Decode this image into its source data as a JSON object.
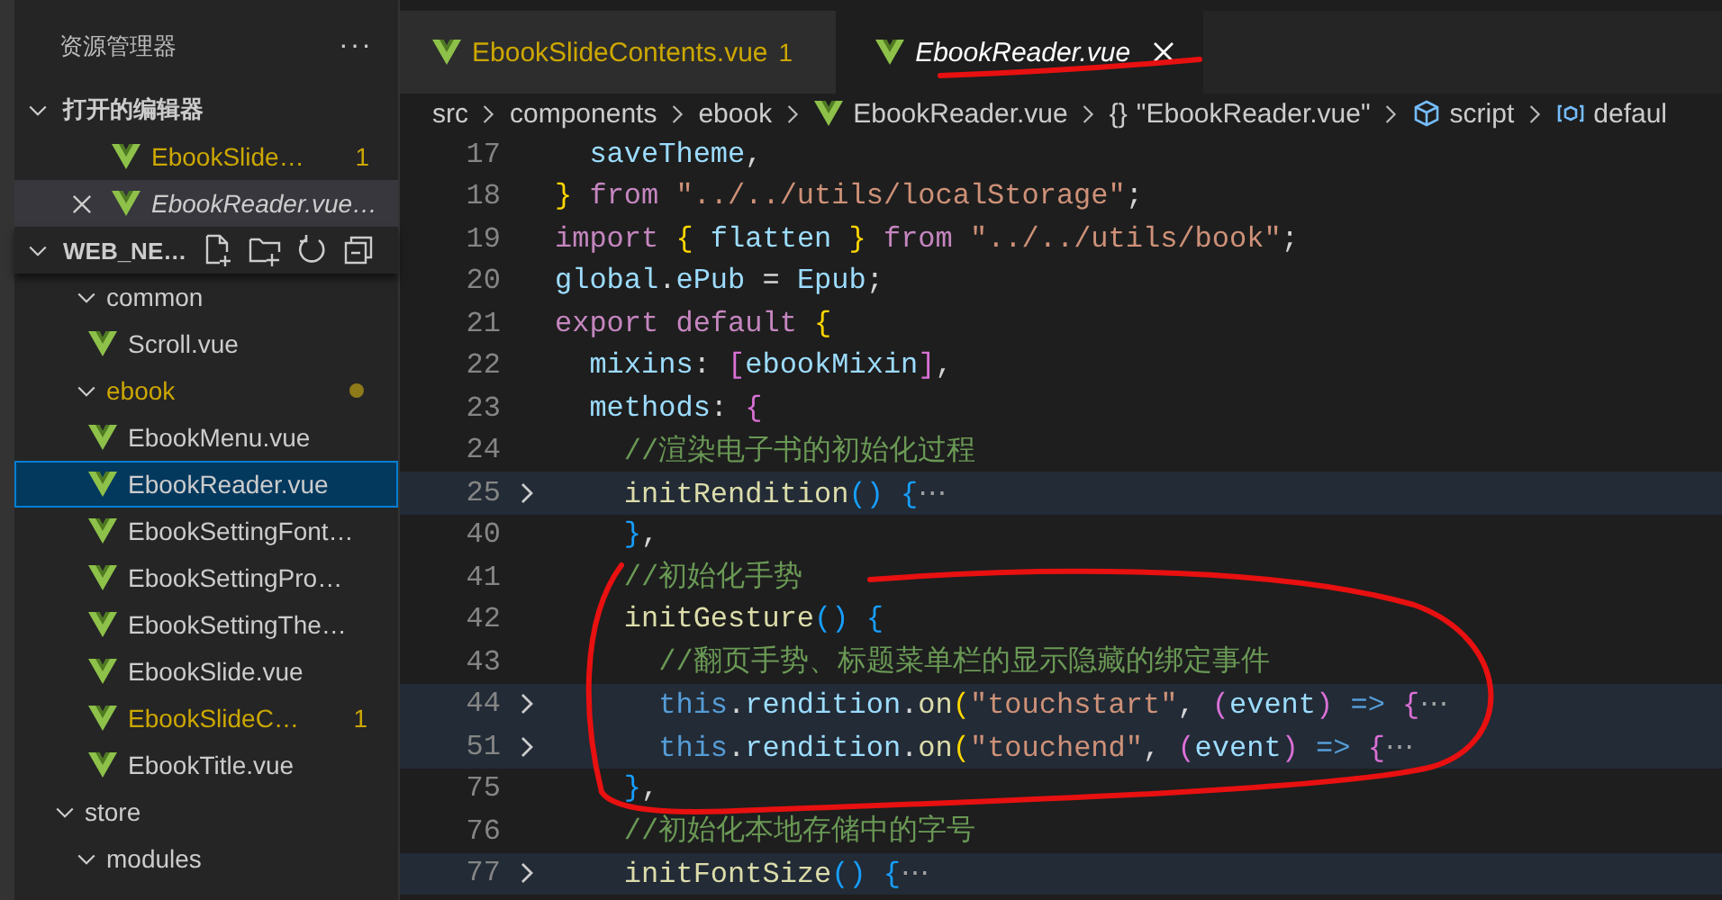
{
  "explorer": {
    "title": "资源管理器",
    "more": "···",
    "open_editors": {
      "title": "打开的编辑器",
      "expanded": true,
      "items": [
        {
          "label": "EbookSlide…",
          "problem": true,
          "badge": "1",
          "preview": false,
          "selected": false
        },
        {
          "label": "EbookReader.vue…",
          "problem": false,
          "preview": true,
          "selected": true
        }
      ]
    },
    "project": {
      "title": "WEB_NE…",
      "expanded": true,
      "tree": [
        {
          "children": [
            {
              "label": "common",
              "kind": "folder",
              "expanded": true,
              "problem": false,
              "children": [
                {
                  "label": "Scroll.vue",
                  "kind": "file",
                  "selected": false,
                  "problem": false
                }
              ]
            },
            {
              "label": "ebook",
              "kind": "folder",
              "expanded": true,
              "problem": true,
              "children": [
                {
                  "label": "EbookMenu.vue",
                  "kind": "file",
                  "selected": false,
                  "problem": false
                },
                {
                  "label": "EbookReader.vue",
                  "kind": "file",
                  "selected": true,
                  "problem": false
                },
                {
                  "label": "EbookSettingFont…",
                  "kind": "file",
                  "selected": false,
                  "problem": false
                },
                {
                  "label": "EbookSettingPro…",
                  "kind": "file",
                  "selected": false,
                  "problem": false
                },
                {
                  "label": "EbookSettingThe…",
                  "kind": "file",
                  "selected": false,
                  "problem": false
                },
                {
                  "label": "EbookSlide.vue",
                  "kind": "file",
                  "selected": false,
                  "problem": false
                },
                {
                  "label": "EbookSlideC…",
                  "kind": "file",
                  "selected": false,
                  "problem": true,
                  "badge": "1"
                },
                {
                  "label": "EbookTitle.vue",
                  "kind": "file",
                  "selected": false,
                  "problem": false
                }
              ]
            }
          ]
        },
        {
          "label": "store",
          "kind": "folder",
          "expanded": true,
          "problem": false,
          "children": [
            {
              "label": "modules",
              "kind": "folder",
              "expanded": true,
              "problem": false
            }
          ]
        }
      ]
    }
  },
  "tabs": [
    {
      "label": "EbookSlideContents.vue",
      "badge": "1",
      "problem": true,
      "preview": false,
      "selected": false
    },
    {
      "label": "EbookReader.vue",
      "problem": false,
      "preview": true,
      "selected": true
    }
  ],
  "breadcrumb": [
    {
      "label": "src",
      "kind": "folder"
    },
    {
      "label": "components",
      "kind": "folder"
    },
    {
      "label": "ebook",
      "kind": "folder"
    },
    {
      "label": "EbookReader.vue",
      "kind": "vue"
    },
    {
      "label": "\"EbookReader.vue\"",
      "kind": "module",
      "symbol": "{}"
    },
    {
      "label": "script",
      "kind": "element"
    },
    {
      "label": "defaul",
      "kind": "field"
    }
  ],
  "code": [
    {
      "number": "17",
      "folded": false,
      "tokens": [
        {
          "text": "  saveTheme",
          "kind": "var"
        },
        {
          "text": ",",
          "kind": "plain"
        }
      ]
    },
    {
      "number": "18",
      "folded": false,
      "tokens": [
        {
          "text": "}",
          "kind": "b1"
        },
        {
          "text": " from ",
          "kind": "kw"
        },
        {
          "text": "\"../../utils/localStorage\"",
          "kind": "str"
        },
        {
          "text": ";",
          "kind": "plain"
        }
      ]
    },
    {
      "number": "19",
      "folded": false,
      "tokens": [
        {
          "text": "import ",
          "kind": "kw"
        },
        {
          "text": "{",
          "kind": "b1"
        },
        {
          "text": " flatten ",
          "kind": "var"
        },
        {
          "text": "}",
          "kind": "b1"
        },
        {
          "text": " from ",
          "kind": "kw"
        },
        {
          "text": "\"../../utils/book\"",
          "kind": "str"
        },
        {
          "text": ";",
          "kind": "plain"
        }
      ]
    },
    {
      "number": "20",
      "folded": false,
      "tokens": [
        {
          "text": "global",
          "kind": "var"
        },
        {
          "text": ".",
          "kind": "plain"
        },
        {
          "text": "ePub",
          "kind": "var"
        },
        {
          "text": " = ",
          "kind": "plain"
        },
        {
          "text": "Epub",
          "kind": "var"
        },
        {
          "text": ";",
          "kind": "plain"
        }
      ]
    },
    {
      "number": "21",
      "folded": false,
      "tokens": [
        {
          "text": "export default ",
          "kind": "kw"
        },
        {
          "text": "{",
          "kind": "b1"
        }
      ]
    },
    {
      "number": "22",
      "folded": false,
      "tokens": [
        {
          "text": "  mixins",
          "kind": "var"
        },
        {
          "text": ": ",
          "kind": "plain"
        },
        {
          "text": "[",
          "kind": "b2"
        },
        {
          "text": "ebookMixin",
          "kind": "var"
        },
        {
          "text": "]",
          "kind": "b2"
        },
        {
          "text": ",",
          "kind": "plain"
        }
      ]
    },
    {
      "number": "23",
      "folded": false,
      "tokens": [
        {
          "text": "  methods",
          "kind": "var"
        },
        {
          "text": ": ",
          "kind": "plain"
        },
        {
          "text": "{",
          "kind": "b2"
        }
      ]
    },
    {
      "number": "24",
      "folded": false,
      "tokens": [
        {
          "text": "    //渲染电子书的初始化过程",
          "kind": "com"
        }
      ]
    },
    {
      "number": "25",
      "folded": true,
      "tokens": [
        {
          "text": "    initRendition",
          "kind": "fn"
        },
        {
          "text": "()",
          "kind": "b3"
        },
        {
          "text": " {",
          "kind": "b3"
        },
        {
          "text": "⋯",
          "kind": "fold"
        }
      ]
    },
    {
      "number": "40",
      "folded": false,
      "tokens": [
        {
          "text": "    }",
          "kind": "b3"
        },
        {
          "text": ",",
          "kind": "plain"
        }
      ]
    },
    {
      "number": "41",
      "folded": false,
      "tokens": [
        {
          "text": "    //初始化手势",
          "kind": "com"
        }
      ]
    },
    {
      "number": "42",
      "folded": false,
      "tokens": [
        {
          "text": "    initGesture",
          "kind": "fn"
        },
        {
          "text": "()",
          "kind": "b3"
        },
        {
          "text": " {",
          "kind": "b3"
        }
      ]
    },
    {
      "number": "43",
      "folded": false,
      "tokens": [
        {
          "text": "      //翻页手势、标题菜单栏的显示隐藏的绑定事件",
          "kind": "com"
        }
      ]
    },
    {
      "number": "44",
      "folded": true,
      "tokens": [
        {
          "text": "      this",
          "kind": "this"
        },
        {
          "text": ".",
          "kind": "plain"
        },
        {
          "text": "rendition",
          "kind": "var"
        },
        {
          "text": ".",
          "kind": "plain"
        },
        {
          "text": "on",
          "kind": "fn"
        },
        {
          "text": "(",
          "kind": "b1"
        },
        {
          "text": "\"touchstart\"",
          "kind": "str"
        },
        {
          "text": ", ",
          "kind": "plain"
        },
        {
          "text": "(",
          "kind": "b2"
        },
        {
          "text": "event",
          "kind": "var"
        },
        {
          "text": ")",
          "kind": "b2"
        },
        {
          "text": " => ",
          "kind": "this"
        },
        {
          "text": "{",
          "kind": "b2"
        },
        {
          "text": "⋯",
          "kind": "fold"
        }
      ]
    },
    {
      "number": "51",
      "folded": true,
      "tokens": [
        {
          "text": "      this",
          "kind": "this"
        },
        {
          "text": ".",
          "kind": "plain"
        },
        {
          "text": "rendition",
          "kind": "var"
        },
        {
          "text": ".",
          "kind": "plain"
        },
        {
          "text": "on",
          "kind": "fn"
        },
        {
          "text": "(",
          "kind": "b1"
        },
        {
          "text": "\"touchend\"",
          "kind": "str"
        },
        {
          "text": ", ",
          "kind": "plain"
        },
        {
          "text": "(",
          "kind": "b2"
        },
        {
          "text": "event",
          "kind": "var"
        },
        {
          "text": ")",
          "kind": "b2"
        },
        {
          "text": " => ",
          "kind": "this"
        },
        {
          "text": "{",
          "kind": "b2"
        },
        {
          "text": "⋯",
          "kind": "fold"
        }
      ]
    },
    {
      "number": "75",
      "folded": false,
      "tokens": [
        {
          "text": "    }",
          "kind": "b3"
        },
        {
          "text": ",",
          "kind": "plain"
        }
      ]
    },
    {
      "number": "76",
      "folded": false,
      "tokens": [
        {
          "text": "    //初始化本地存储中的字号",
          "kind": "com"
        }
      ]
    },
    {
      "number": "77",
      "folded": true,
      "tokens": [
        {
          "text": "    initFontSize",
          "kind": "fn"
        },
        {
          "text": "()",
          "kind": "b3"
        },
        {
          "text": " {",
          "kind": "b3"
        },
        {
          "text": "⋯",
          "kind": "fold"
        }
      ]
    }
  ]
}
